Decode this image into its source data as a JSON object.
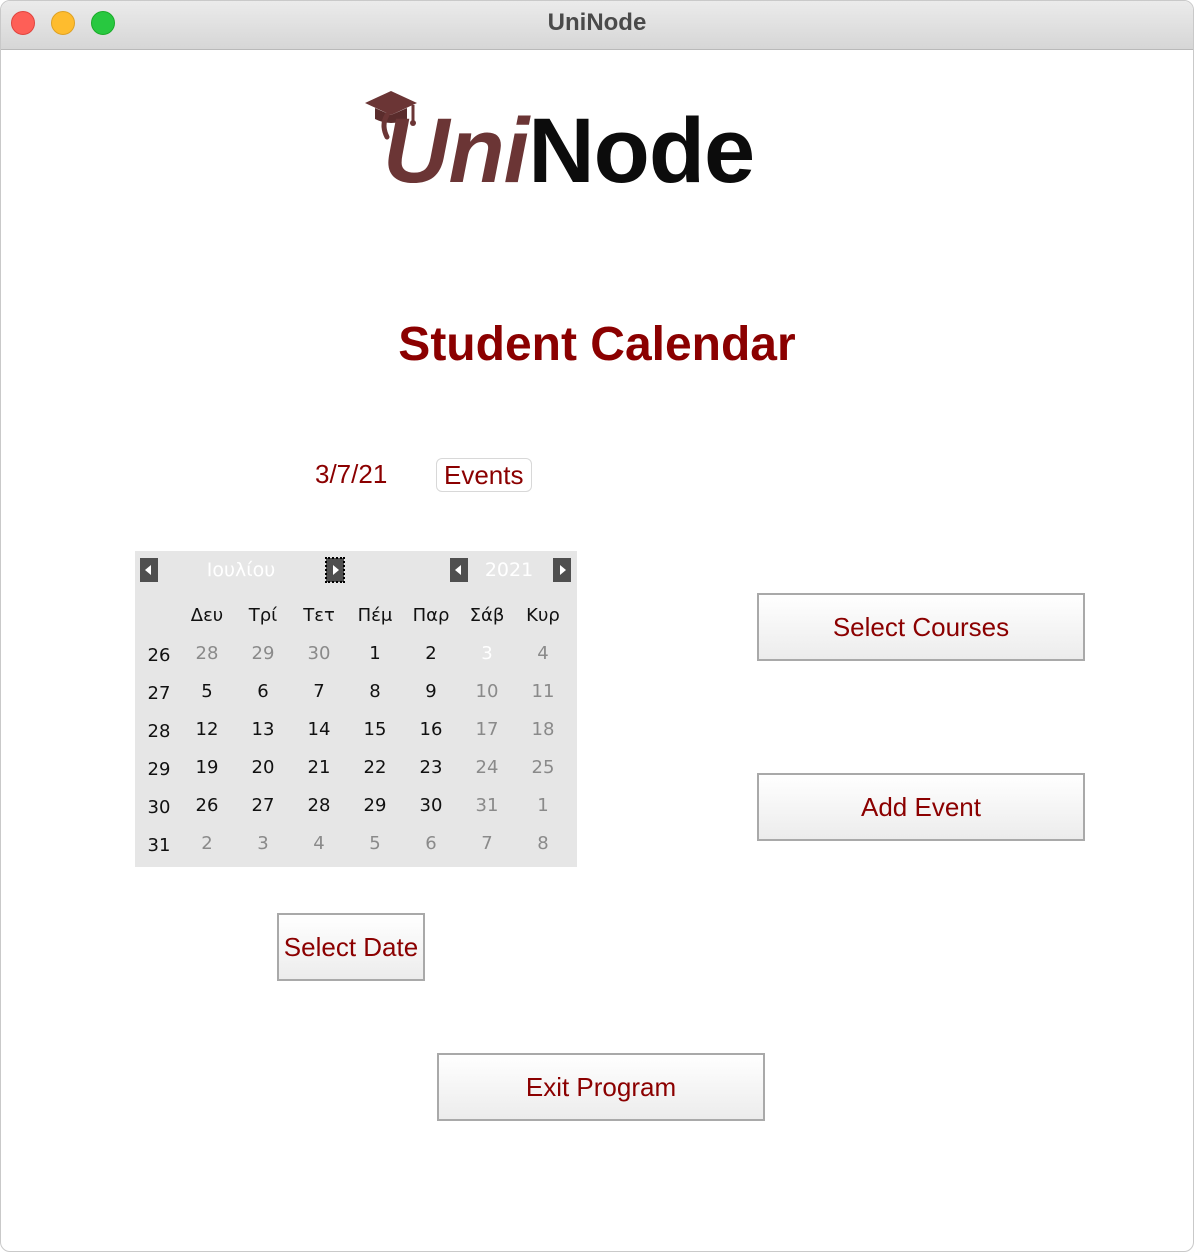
{
  "window": {
    "title": "UniNode"
  },
  "logo": {
    "text_uni": "Uni",
    "text_node": "Node",
    "uni_color": "#6b3535",
    "node_color": "#0c0c0c"
  },
  "heading": "Student Calendar",
  "selected_date_label": "3/7/21",
  "events_button_label": "Events",
  "calendar": {
    "month": "Ιουλίου",
    "year": "2021",
    "weekdays": [
      "Δευ",
      "Τρί",
      "Τετ",
      "Πέμ",
      "Παρ",
      "Σάβ",
      "Κυρ"
    ],
    "weeks": [
      {
        "number": "26",
        "days": [
          {
            "d": "28",
            "other": true
          },
          {
            "d": "29",
            "other": true
          },
          {
            "d": "30",
            "other": true
          },
          {
            "d": "1"
          },
          {
            "d": "2"
          },
          {
            "d": "3",
            "selected": true
          },
          {
            "d": "4",
            "weekend": true
          }
        ]
      },
      {
        "number": "27",
        "days": [
          {
            "d": "5"
          },
          {
            "d": "6"
          },
          {
            "d": "7"
          },
          {
            "d": "8"
          },
          {
            "d": "9"
          },
          {
            "d": "10",
            "weekend": true
          },
          {
            "d": "11",
            "weekend": true
          }
        ]
      },
      {
        "number": "28",
        "days": [
          {
            "d": "12"
          },
          {
            "d": "13"
          },
          {
            "d": "14"
          },
          {
            "d": "15"
          },
          {
            "d": "16"
          },
          {
            "d": "17",
            "weekend": true
          },
          {
            "d": "18",
            "weekend": true
          }
        ]
      },
      {
        "number": "29",
        "days": [
          {
            "d": "19"
          },
          {
            "d": "20"
          },
          {
            "d": "21"
          },
          {
            "d": "22"
          },
          {
            "d": "23"
          },
          {
            "d": "24",
            "weekend": true
          },
          {
            "d": "25",
            "weekend": true
          }
        ]
      },
      {
        "number": "30",
        "days": [
          {
            "d": "26"
          },
          {
            "d": "27"
          },
          {
            "d": "28"
          },
          {
            "d": "29"
          },
          {
            "d": "30"
          },
          {
            "d": "31",
            "weekend": true
          },
          {
            "d": "1",
            "other": true
          }
        ]
      },
      {
        "number": "31",
        "days": [
          {
            "d": "2",
            "other": true
          },
          {
            "d": "3",
            "other": true
          },
          {
            "d": "4",
            "other": true
          },
          {
            "d": "5",
            "other": true
          },
          {
            "d": "6",
            "other": true
          },
          {
            "d": "7",
            "other": true
          },
          {
            "d": "8",
            "other": true
          }
        ]
      }
    ]
  },
  "buttons": {
    "select_courses": "Select Courses",
    "add_event": "Add Event",
    "select_date": "Select Date",
    "exit_program": "Exit Program"
  },
  "colors": {
    "accent": "#8b0000",
    "calendar_bg": "#e6e6e6"
  }
}
